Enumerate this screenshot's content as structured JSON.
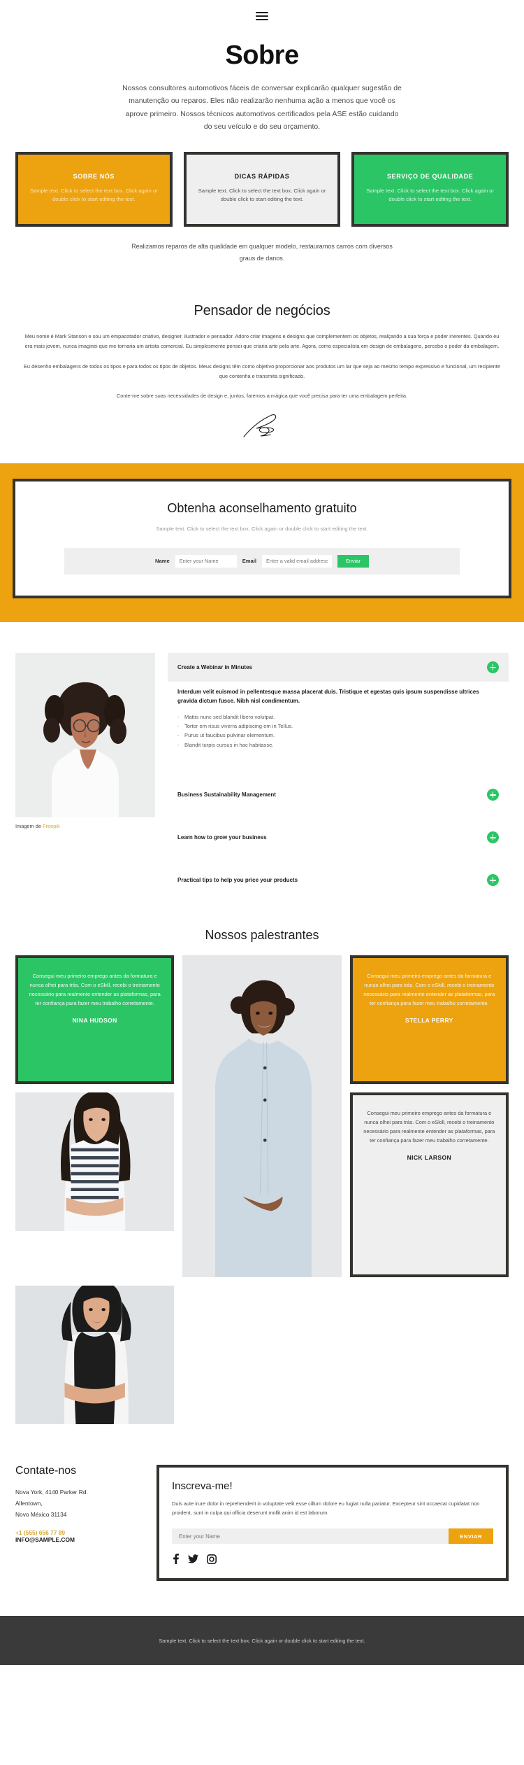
{
  "header": {
    "menu_icon": "hamburger-icon"
  },
  "hero": {
    "title": "Sobre",
    "paragraph": "Nossos consultores automotivos fáceis de conversar explicarão qualquer sugestão de manutenção ou reparos. Eles não realizarão nenhuma ação a menos que você os aprove primeiro. Nossos técnicos automotivos certificados pela ASE estão cuidando do seu veículo e do seu orçamento."
  },
  "cards": [
    {
      "title": "SOBRE NÓS",
      "text": "Sample text. Click to select the text box. Click again or double click to start editing the text.",
      "color": "#eda20f"
    },
    {
      "title": "DICAS RÁPIDAS",
      "text": "Sample text. Click to select the text box. Click again or double click to start editing the text.",
      "color": "#efefef"
    },
    {
      "title": "SERVIÇO DE QUALIDADE",
      "text": "Sample text. Click to select the text box. Click again or double click to start editing the text.",
      "color": "#2cc566"
    }
  ],
  "cards_note": "Realizamos reparos de alta qualidade em qualquer modelo, restauramos carros com diversos graus de danos.",
  "thinker": {
    "title": "Pensador de negócios",
    "p1": "Meu nome é Mark Stanson e sou um empacotador criativo, designer, ilustrador e pensador. Adoro criar imagens e designs que complementem os objetos, realçando a sua força e poder inerentes. Quando eu era mais jovem, nunca imaginei que me tornaria um artista comercial. Eu simplesmente pensei que criaria arte pela arte. Agora, como especialista em design de embalagens, percebo o poder da embalagem.",
    "p2": "Eu desenho embalagens de todos os tipos e para todos os tipos de objetos. Meus designs têm como objetivo proporcionar aos produtos um lar que seja ao mesmo tempo expressivo e funcional, um recipiente que contenha e transmita significado.",
    "p3": "Conte-me sobre suas necessidades de design e, juntos, faremos a mágica que você precisa para ter uma embalagem perfeita.",
    "signature_alt": "signature"
  },
  "advice": {
    "title": "Obtenha aconselhamento gratuito",
    "lead": "Sample text. Click to select the text box. Click again or double click to start editing the text.",
    "name_label": "Name",
    "name_placeholder": "Enter your Name",
    "email_label": "Email",
    "email_placeholder": "Enter a valid email address",
    "submit_label": "Enviar",
    "band_color": "#eda20f",
    "button_color": "#2cc566"
  },
  "accordion": {
    "image_credit_prefix": "Imagem de ",
    "image_credit_link": "Freepik",
    "items": [
      {
        "title": "Create a Webinar in Minutes",
        "open": true,
        "body_bold": "Interdum velit euismod in pellentesque massa placerat duis. Tristique et egestas quis ipsum suspendisse ultrices gravida dictum fusce. Nibh nisl condimentum.",
        "bullets": [
          "Mattis nunc sed blandit libero volutpat.",
          "Tortor em risus viverra adipiscing em in Tellus.",
          "Purus ut faucibus pulvinar elementum.",
          "Blandit turpis cursus in hac habitasse."
        ]
      },
      {
        "title": "Business Sustainability Management",
        "open": false
      },
      {
        "title": "Learn how to grow your business",
        "open": false
      },
      {
        "title": "Practical tips to help you price your products",
        "open": false
      }
    ]
  },
  "speakers": {
    "title": "Nossos palestrantes",
    "quote": "Consegui meu primeiro emprego antes da formatura e nunca olhei para trás. Com o eSkill, recebi o treinamento necessário para realmente entender as plataformas, para ter confiança para fazer meu trabalho corretamente.",
    "people": [
      {
        "name": "NINA HUDSON",
        "style": "green"
      },
      {
        "name": "STELLA PERRY",
        "style": "orange"
      },
      {
        "name": "NICK LARSON",
        "style": "grey"
      }
    ]
  },
  "contact": {
    "title": "Contate-nos",
    "address_line1": "Nova York, 4140 Parker Rd.",
    "address_line2": "Allentown,",
    "address_line3": "Novo México 31134",
    "phone": "+1 (555) 656 77 89",
    "email": "INFO@SAMPLE.COM",
    "phone_color": "#d8a832"
  },
  "subscribe": {
    "title": "Inscreva-me!",
    "text": "Duis aute irure dolor in reprehenderit in voluptate velit esse cillum dolore eu fugiat nulla pariatur. Excepteur sint occaecat cupidatat non proident, sunt in culpa qui officia deserunt mollit anim id est laborum.",
    "placeholder": "Enter your Name",
    "button_label": "ENVIAR",
    "button_color": "#eda20f",
    "socials": [
      "facebook-icon",
      "twitter-icon",
      "instagram-icon"
    ]
  },
  "footer": {
    "text": "Sample text. Click to select the text box. Click again or double click to start editing the text."
  }
}
